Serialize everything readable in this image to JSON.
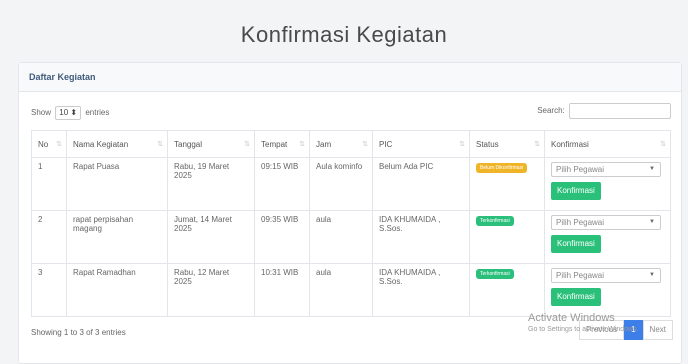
{
  "page": {
    "title": "Konfirmasi Kegiatan"
  },
  "card": {
    "header": "Daftar Kegiatan"
  },
  "controls": {
    "show_label": "Show",
    "entries_value": "10",
    "entries_label": "entries",
    "search_label": "Search:",
    "search_value": ""
  },
  "table": {
    "headers": [
      "No",
      "Nama Kegiatan",
      "Tanggal",
      "Tempat",
      "Jam",
      "PIC",
      "Status",
      "Konfirmasi"
    ],
    "rows": [
      {
        "no": "1",
        "nama": "Rapat Puasa",
        "tanggal": "Rabu, 19 Maret 2025",
        "tempat": "09:15 WIB",
        "jam": "Aula kominfo",
        "pic": "Belum Ada PIC",
        "status": "Belum Dikonfirmasi",
        "pegawai": "Pilih Pegawai",
        "button": "Konfirmasi"
      },
      {
        "no": "2",
        "nama": "rapat perpisahan magang",
        "tanggal": "Jumat, 14 Maret 2025",
        "tempat": "09:35 WIB",
        "jam": "aula",
        "pic": "IDA KHUMAIDA , S.Sos.",
        "status": "Terkonfirmasi",
        "pegawai": "Pilih Pegawai",
        "button": "Konfirmasi"
      },
      {
        "no": "3",
        "nama": "Rapat Ramadhan",
        "tanggal": "Rabu, 12 Maret 2025",
        "tempat": "10:31 WIB",
        "jam": "aula",
        "pic": "IDA KHUMAIDA , S.Sos.",
        "status": "Terkonfirmasi",
        "pegawai": "Pilih Pegawai",
        "button": "Konfirmasi"
      }
    ]
  },
  "footer": {
    "info": "Showing 1 to 3 of 3 entries",
    "previous": "Previous",
    "page": "1",
    "next": "Next"
  },
  "watermark": {
    "line1": "Activate Windows",
    "line2": "Go to Settings to activate Windows."
  },
  "colors": {
    "warning": "#f0b429",
    "success": "#2bbf7c",
    "primary": "#3d7ee8"
  },
  "icons": {
    "sort": "sort-icon",
    "caret": "caret-down-icon"
  }
}
